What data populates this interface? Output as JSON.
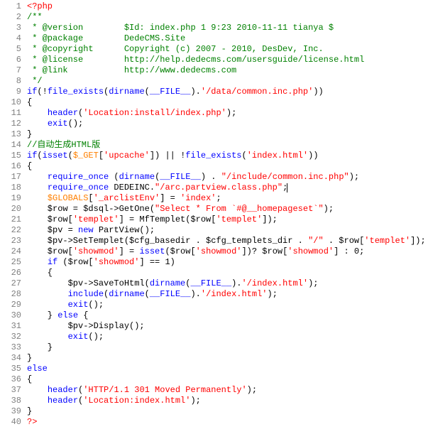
{
  "lines": [
    {
      "n": "1",
      "seg": [
        {
          "c": "t-red",
          "t": "<?php"
        }
      ]
    },
    {
      "n": "2",
      "seg": [
        {
          "c": "t-green",
          "t": "/**"
        }
      ]
    },
    {
      "n": "3",
      "seg": [
        {
          "c": "t-green",
          "t": " * @version        $Id: index.php 1 9:23 2010-11-11 tianya $"
        }
      ]
    },
    {
      "n": "4",
      "seg": [
        {
          "c": "t-green",
          "t": " * @package        DedeCMS.Site"
        }
      ]
    },
    {
      "n": "5",
      "seg": [
        {
          "c": "t-green",
          "t": " * @copyright      Copyright (c) 2007 - 2010, DesDev, Inc."
        }
      ]
    },
    {
      "n": "6",
      "seg": [
        {
          "c": "t-green",
          "t": " * @license        http://help.dedecms.com/usersguide/license.html"
        }
      ]
    },
    {
      "n": "7",
      "seg": [
        {
          "c": "t-green",
          "t": " * @link           http://www.dedecms.com"
        }
      ]
    },
    {
      "n": "8",
      "seg": [
        {
          "c": "t-green",
          "t": " */"
        }
      ]
    },
    {
      "n": "9",
      "seg": [
        {
          "c": "t-blue",
          "t": "if"
        },
        {
          "c": "t-black",
          "t": "(!"
        },
        {
          "c": "t-blue",
          "t": "file_exists"
        },
        {
          "c": "t-black",
          "t": "("
        },
        {
          "c": "t-blue",
          "t": "dirname"
        },
        {
          "c": "t-black",
          "t": "("
        },
        {
          "c": "t-blue",
          "t": "__FILE__"
        },
        {
          "c": "t-black",
          "t": ")."
        },
        {
          "c": "t-red",
          "t": "'/data/common.inc.php'"
        },
        {
          "c": "t-black",
          "t": "))"
        }
      ]
    },
    {
      "n": "10",
      "seg": [
        {
          "c": "t-black",
          "t": "{"
        }
      ]
    },
    {
      "n": "11",
      "seg": [
        {
          "c": "t-black",
          "t": "    "
        },
        {
          "c": "t-blue",
          "t": "header"
        },
        {
          "c": "t-black",
          "t": "("
        },
        {
          "c": "t-red",
          "t": "'Location:install/index.php'"
        },
        {
          "c": "t-black",
          "t": ");"
        }
      ]
    },
    {
      "n": "12",
      "seg": [
        {
          "c": "t-black",
          "t": "    "
        },
        {
          "c": "t-blue",
          "t": "exit"
        },
        {
          "c": "t-black",
          "t": "();"
        }
      ]
    },
    {
      "n": "13",
      "seg": [
        {
          "c": "t-black",
          "t": "}"
        }
      ]
    },
    {
      "n": "14",
      "seg": [
        {
          "c": "t-green",
          "t": "//自动生成HTML版"
        }
      ]
    },
    {
      "n": "15",
      "seg": [
        {
          "c": "t-blue",
          "t": "if"
        },
        {
          "c": "t-black",
          "t": "("
        },
        {
          "c": "t-blue",
          "t": "isset"
        },
        {
          "c": "t-black",
          "t": "("
        },
        {
          "c": "t-orange",
          "t": "$_GET"
        },
        {
          "c": "t-black",
          "t": "["
        },
        {
          "c": "t-red",
          "t": "'upcache'"
        },
        {
          "c": "t-black",
          "t": "]) || !"
        },
        {
          "c": "t-blue",
          "t": "file_exists"
        },
        {
          "c": "t-black",
          "t": "("
        },
        {
          "c": "t-red",
          "t": "'index.html'"
        },
        {
          "c": "t-black",
          "t": "))"
        }
      ]
    },
    {
      "n": "16",
      "seg": [
        {
          "c": "t-black",
          "t": "{"
        }
      ]
    },
    {
      "n": "17",
      "seg": [
        {
          "c": "t-black",
          "t": "    "
        },
        {
          "c": "t-blue",
          "t": "require_once"
        },
        {
          "c": "t-black",
          "t": " ("
        },
        {
          "c": "t-blue",
          "t": "dirname"
        },
        {
          "c": "t-black",
          "t": "("
        },
        {
          "c": "t-blue",
          "t": "__FILE__"
        },
        {
          "c": "t-black",
          "t": ") . "
        },
        {
          "c": "t-red",
          "t": "\"/include/common.inc.php\""
        },
        {
          "c": "t-black",
          "t": ");"
        }
      ]
    },
    {
      "n": "18",
      "seg": [
        {
          "c": "t-black",
          "t": "    "
        },
        {
          "c": "t-blue",
          "t": "require_once"
        },
        {
          "c": "t-black",
          "t": " DEDEINC."
        },
        {
          "c": "t-red",
          "t": "\"/arc.partview.class.php\""
        },
        {
          "c": "t-black",
          "t": ";"
        },
        {
          "c": "cursor",
          "t": ""
        }
      ]
    },
    {
      "n": "19",
      "seg": [
        {
          "c": "t-black",
          "t": "    "
        },
        {
          "c": "t-orange",
          "t": "$GLOBALS"
        },
        {
          "c": "t-black",
          "t": "["
        },
        {
          "c": "t-red",
          "t": "'_arclistEnv'"
        },
        {
          "c": "t-black",
          "t": "] = "
        },
        {
          "c": "t-red",
          "t": "'index'"
        },
        {
          "c": "t-black",
          "t": ";"
        }
      ]
    },
    {
      "n": "20",
      "seg": [
        {
          "c": "t-black",
          "t": "    $row = $dsql->GetOne("
        },
        {
          "c": "t-red",
          "t": "\"Select * From `#@__homepageset`\""
        },
        {
          "c": "t-black",
          "t": ");"
        }
      ]
    },
    {
      "n": "21",
      "seg": [
        {
          "c": "t-black",
          "t": "    $row["
        },
        {
          "c": "t-red",
          "t": "'templet'"
        },
        {
          "c": "t-black",
          "t": "] = MfTemplet($row["
        },
        {
          "c": "t-red",
          "t": "'templet'"
        },
        {
          "c": "t-black",
          "t": "]);"
        }
      ]
    },
    {
      "n": "22",
      "seg": [
        {
          "c": "t-black",
          "t": "    $pv = "
        },
        {
          "c": "t-blue",
          "t": "new"
        },
        {
          "c": "t-black",
          "t": " PartView();"
        }
      ]
    },
    {
      "n": "23",
      "seg": [
        {
          "c": "t-black",
          "t": "    $pv->SetTemplet($cfg_basedir . $cfg_templets_dir . "
        },
        {
          "c": "t-red",
          "t": "\"/\""
        },
        {
          "c": "t-black",
          "t": " . $row["
        },
        {
          "c": "t-red",
          "t": "'templet'"
        },
        {
          "c": "t-black",
          "t": "]);"
        }
      ]
    },
    {
      "n": "24",
      "seg": [
        {
          "c": "t-black",
          "t": "    $row["
        },
        {
          "c": "t-red",
          "t": "'showmod'"
        },
        {
          "c": "t-black",
          "t": "] = "
        },
        {
          "c": "t-blue",
          "t": "isset"
        },
        {
          "c": "t-black",
          "t": "($row["
        },
        {
          "c": "t-red",
          "t": "'showmod'"
        },
        {
          "c": "t-black",
          "t": "])? $row["
        },
        {
          "c": "t-red",
          "t": "'showmod'"
        },
        {
          "c": "t-black",
          "t": "] : 0;"
        }
      ]
    },
    {
      "n": "25",
      "seg": [
        {
          "c": "t-black",
          "t": "    "
        },
        {
          "c": "t-blue",
          "t": "if"
        },
        {
          "c": "t-black",
          "t": " ($row["
        },
        {
          "c": "t-red",
          "t": "'showmod'"
        },
        {
          "c": "t-black",
          "t": "] == 1)"
        }
      ]
    },
    {
      "n": "26",
      "seg": [
        {
          "c": "t-black",
          "t": "    {"
        }
      ]
    },
    {
      "n": "27",
      "seg": [
        {
          "c": "t-black",
          "t": "        $pv->SaveToHtml("
        },
        {
          "c": "t-blue",
          "t": "dirname"
        },
        {
          "c": "t-black",
          "t": "("
        },
        {
          "c": "t-blue",
          "t": "__FILE__"
        },
        {
          "c": "t-black",
          "t": ")."
        },
        {
          "c": "t-red",
          "t": "'/index.html'"
        },
        {
          "c": "t-black",
          "t": ");"
        }
      ]
    },
    {
      "n": "28",
      "seg": [
        {
          "c": "t-black",
          "t": "        "
        },
        {
          "c": "t-blue",
          "t": "include"
        },
        {
          "c": "t-black",
          "t": "("
        },
        {
          "c": "t-blue",
          "t": "dirname"
        },
        {
          "c": "t-black",
          "t": "("
        },
        {
          "c": "t-blue",
          "t": "__FILE__"
        },
        {
          "c": "t-black",
          "t": ")."
        },
        {
          "c": "t-red",
          "t": "'/index.html'"
        },
        {
          "c": "t-black",
          "t": ");"
        }
      ]
    },
    {
      "n": "29",
      "seg": [
        {
          "c": "t-black",
          "t": "        "
        },
        {
          "c": "t-blue",
          "t": "exit"
        },
        {
          "c": "t-black",
          "t": "();"
        }
      ]
    },
    {
      "n": "30",
      "seg": [
        {
          "c": "t-black",
          "t": "    } "
        },
        {
          "c": "t-blue",
          "t": "else"
        },
        {
          "c": "t-black",
          "t": " {"
        }
      ]
    },
    {
      "n": "31",
      "seg": [
        {
          "c": "t-black",
          "t": "        $pv->Display();"
        }
      ]
    },
    {
      "n": "32",
      "seg": [
        {
          "c": "t-black",
          "t": "        "
        },
        {
          "c": "t-blue",
          "t": "exit"
        },
        {
          "c": "t-black",
          "t": "();"
        }
      ]
    },
    {
      "n": "33",
      "seg": [
        {
          "c": "t-black",
          "t": "    }"
        }
      ]
    },
    {
      "n": "34",
      "seg": [
        {
          "c": "t-black",
          "t": "}"
        }
      ]
    },
    {
      "n": "35",
      "seg": [
        {
          "c": "t-blue",
          "t": "else"
        }
      ]
    },
    {
      "n": "36",
      "seg": [
        {
          "c": "t-black",
          "t": "{"
        }
      ]
    },
    {
      "n": "37",
      "seg": [
        {
          "c": "t-black",
          "t": "    "
        },
        {
          "c": "t-blue",
          "t": "header"
        },
        {
          "c": "t-black",
          "t": "("
        },
        {
          "c": "t-red",
          "t": "'HTTP/1.1 301 Moved Permanently'"
        },
        {
          "c": "t-black",
          "t": ");"
        }
      ]
    },
    {
      "n": "38",
      "seg": [
        {
          "c": "t-black",
          "t": "    "
        },
        {
          "c": "t-blue",
          "t": "header"
        },
        {
          "c": "t-black",
          "t": "("
        },
        {
          "c": "t-red",
          "t": "'Location:index.html'"
        },
        {
          "c": "t-black",
          "t": ");"
        }
      ]
    },
    {
      "n": "39",
      "seg": [
        {
          "c": "t-black",
          "t": "}"
        }
      ]
    },
    {
      "n": "40",
      "seg": [
        {
          "c": "t-red",
          "t": "?>"
        }
      ]
    }
  ]
}
